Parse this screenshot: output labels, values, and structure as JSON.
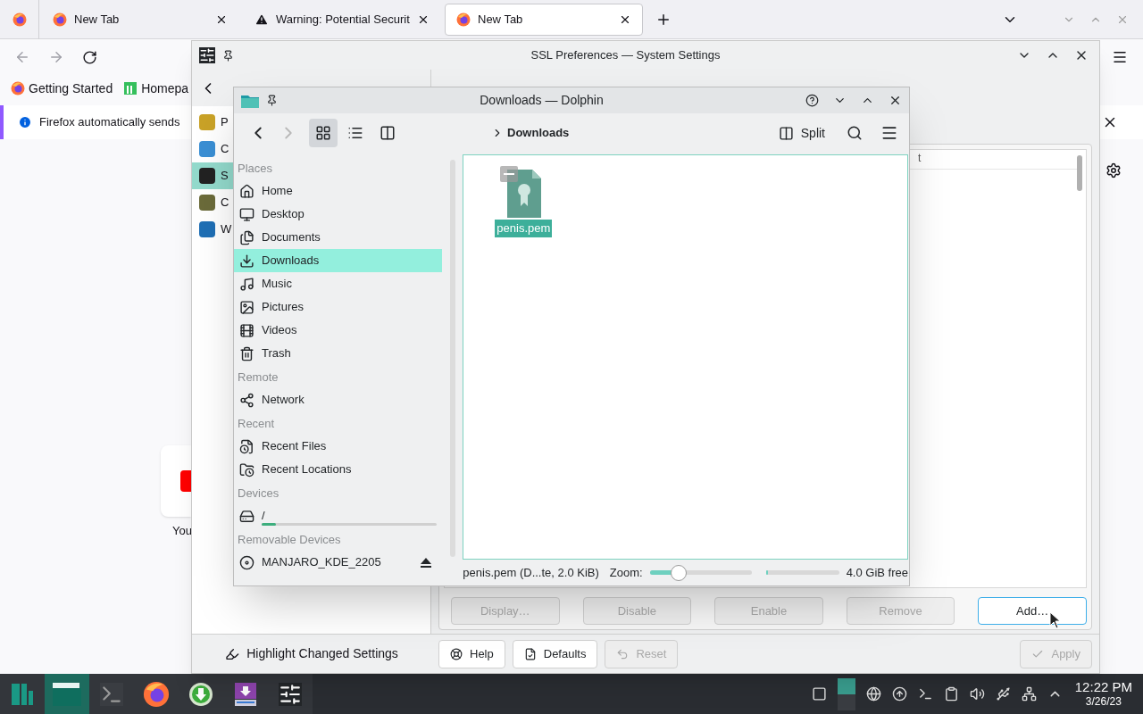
{
  "firefox": {
    "tabs": [
      {
        "kind": "pinned",
        "selected": false
      },
      {
        "kind": "page",
        "label": "New Tab",
        "selected": false
      },
      {
        "kind": "warning",
        "label": "Warning: Potential Securit",
        "selected": false
      },
      {
        "kind": "page",
        "label": "New Tab",
        "selected": true
      }
    ],
    "bookmarks": [
      {
        "label": "Getting Started"
      },
      {
        "label": "Homepa"
      }
    ],
    "notification": "Firefox automatically sends",
    "shortcut": "You"
  },
  "settings": {
    "title": "SSL Preferences — System Settings",
    "sidebar": [
      {
        "label": "P",
        "selected": false
      },
      {
        "label": "C",
        "selected": false
      },
      {
        "label": "S",
        "selected": true
      },
      {
        "label": "C",
        "selected": false
      },
      {
        "label": "W",
        "selected": false
      }
    ],
    "list_header": "t",
    "actions": [
      {
        "label": "Display…",
        "disabled": true,
        "focused": false
      },
      {
        "label": "Disable",
        "disabled": true,
        "focused": false
      },
      {
        "label": "Enable",
        "disabled": true,
        "focused": false
      },
      {
        "label": "Remove",
        "disabled": true,
        "focused": false
      },
      {
        "label": "Add…",
        "disabled": false,
        "focused": true
      }
    ],
    "highlight": "Highlight Changed Settings",
    "footer_buttons": [
      {
        "label": "Help",
        "disabled": false
      },
      {
        "label": "Defaults",
        "disabled": false
      },
      {
        "label": "Reset",
        "disabled": true
      }
    ],
    "apply": {
      "label": "Apply",
      "disabled": true
    }
  },
  "dolphin": {
    "title": "Downloads — Dolphin",
    "breadcrumb": "Downloads",
    "split": "Split",
    "view_modes": [
      {
        "selected": true
      },
      {
        "selected": false
      },
      {
        "selected": false
      }
    ],
    "places": [
      {
        "heading": "Places",
        "items": [
          {
            "kind": "place",
            "label": "Home",
            "selected": false
          },
          {
            "kind": "place",
            "label": "Desktop",
            "selected": false
          },
          {
            "kind": "place",
            "label": "Documents",
            "selected": false
          },
          {
            "kind": "place",
            "label": "Downloads",
            "selected": true
          },
          {
            "kind": "place",
            "label": "Music",
            "selected": false
          },
          {
            "kind": "place",
            "label": "Pictures",
            "selected": false
          },
          {
            "kind": "place",
            "label": "Videos",
            "selected": false
          },
          {
            "kind": "place",
            "label": "Trash",
            "selected": false
          }
        ]
      },
      {
        "heading": "Remote",
        "items": [
          {
            "kind": "place",
            "label": "Network",
            "selected": false
          }
        ]
      },
      {
        "heading": "Recent",
        "items": [
          {
            "kind": "place",
            "label": "Recent Files",
            "selected": false
          },
          {
            "kind": "place",
            "label": "Recent Locations",
            "selected": false
          }
        ]
      },
      {
        "heading": "Devices",
        "items": [
          {
            "kind": "device",
            "label": "/",
            "selected": false,
            "level": 0.08
          }
        ]
      },
      {
        "heading": "Removable Devices",
        "items": [
          {
            "kind": "removable",
            "label": "MANJARO_KDE_2205",
            "selected": false
          }
        ]
      }
    ],
    "files": [
      {
        "name": "penis.pem",
        "selected": true
      }
    ],
    "status": "penis.pem (D...te, 2.0 KiB)",
    "zoom_label": "Zoom:",
    "zoom": {
      "level": 0.28
    },
    "free_space": {
      "level": 0.03,
      "label": "4.0 GiB free"
    }
  },
  "taskbar": {
    "apps": [
      {
        "selected": false
      },
      {
        "selected": true
      },
      {
        "selected": false
      },
      {
        "selected": false
      },
      {
        "selected": false
      },
      {
        "selected": false
      },
      {
        "selected": false
      }
    ],
    "time": "12:22 PM",
    "date": "3/26/23"
  }
}
